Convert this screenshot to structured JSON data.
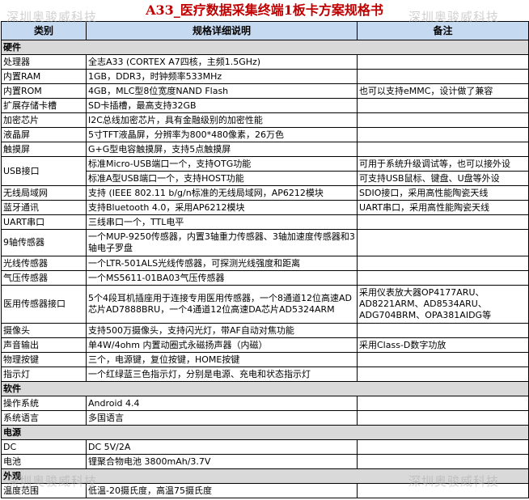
{
  "title": "A33_医疗数据采集终端1板卡方案规格书",
  "watermark": "深圳奥骏威科技",
  "header": {
    "col1": "类别",
    "col2": "规格详细说明",
    "col3": "备注"
  },
  "sections": [
    {
      "name": "硬件",
      "rows": [
        {
          "cat": "处理器",
          "spec": "全志A33 (CORTEX A7四核，主频1.5GHz)",
          "note": ""
        },
        {
          "cat": "内置RAM",
          "spec": "1GB，DDR3，时钟频率533MHz",
          "note": ""
        },
        {
          "cat": "内置ROM",
          "spec": "4GB，MLC型8位宽度NAND Flash",
          "note": "也可以支持eMMC，设计做了兼容"
        },
        {
          "cat": "扩展存储卡槽",
          "spec": "SD卡插槽，最高支持32GB",
          "note": ""
        },
        {
          "cat": "加密芯片",
          "spec": "I2C总线加密芯片，具有金融级别的加密性能",
          "note": ""
        },
        {
          "cat": "液晶屏",
          "spec": "5寸TFT液晶屏，分辨率为800*480像素，26万色",
          "note": ""
        },
        {
          "cat": "触摸屏",
          "spec": "G+G型电容触摸屏，支持5点触摸屏",
          "note": ""
        },
        {
          "cat": "USB接口",
          "spec": "标准Micro-USB端口一个，支持OTG功能",
          "note": "可用于系统升级调试等，也可以接外设",
          "rowspan_cat": 2
        },
        {
          "cat": "",
          "spec": "标准A型USB端口一个，支持HOST功能",
          "note": "可支持USB鼠标、键盘、U盘等外设"
        },
        {
          "cat": "无线局域网",
          "spec": "支持 (IEEE 802.11 b/g/n标准的无线局域网，AP6212模块",
          "note": "SDIO接口，采用高性能陶瓷天线"
        },
        {
          "cat": "蓝牙通讯",
          "spec": "支持Bluetooth 4.0，采用AP6212模块",
          "note": "UART串口，采用高性能陶瓷天线"
        },
        {
          "cat": "UART串口",
          "spec": "三线串口一个，TTL电平",
          "note": ""
        },
        {
          "cat": "9轴传感器",
          "spec": "一个MUP-9250传感器，内置3轴重力传感器、3轴加速度传感器和3轴电子罗盘",
          "note": "",
          "h": 2
        },
        {
          "cat": "光线传感器",
          "spec": "一个LTR-501ALS光线传感器，可探测光线强度和距离",
          "note": ""
        },
        {
          "cat": "气压传感器",
          "spec": "一个MS5611-01BA03气压传感器",
          "note": ""
        },
        {
          "cat": "医用传感器接口",
          "spec": "5个4段耳机插座用于连接专用医用传感器，一个8通道12位高速AD芯片AD7888BRU，一个4通道12位高速DA芯片AD5324ARM",
          "note": "采用仪表放大器OP4177ARU、AD8221ARM、AD8534ARU、ADG704BRM、OPA381AIDG等",
          "h": 3
        },
        {
          "cat": "摄像头",
          "spec": "支持500万摄像头，支持闪光灯，带AF自动对焦功能",
          "note": ""
        },
        {
          "cat": "声音输出",
          "spec": "单4W/4ohm 内置动圈式永磁扬声器（内磁）",
          "note": "采用Class-D数字功放"
        },
        {
          "cat": "物理按键",
          "spec": "三个，电源键，复位按键，HOME按键",
          "note": ""
        },
        {
          "cat": "指示灯",
          "spec": "一个红绿蓝三色指示灯，分别是电源、充电和状态指示灯",
          "note": ""
        }
      ]
    },
    {
      "name": "软件",
      "rows": [
        {
          "cat": "操作系统",
          "spec": "Android 4.4",
          "note": ""
        },
        {
          "cat": "系统语言",
          "spec": "多国语言",
          "note": ""
        }
      ]
    },
    {
      "name": "电源",
      "rows": [
        {
          "cat": "DC",
          "spec": "DC 5V/2A",
          "note": ""
        },
        {
          "cat": "电池",
          "spec": "锂聚合物电池 3800mAh/3.7V",
          "note": ""
        }
      ]
    },
    {
      "name": "外观",
      "rows": [
        {
          "cat": "温度范围",
          "spec": "低温-20摄氏度，高温75摄氏度",
          "note": ""
        }
      ]
    }
  ]
}
